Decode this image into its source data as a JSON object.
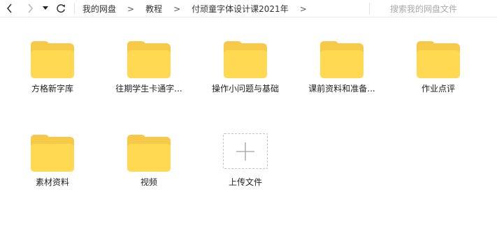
{
  "toolbar": {
    "breadcrumbs": [
      "我的网盘",
      "教程",
      "付顽童字体设计课2021年"
    ],
    "search_placeholder": "搜索我的网盘文件"
  },
  "items": [
    {
      "name": "方格新字库",
      "type": "folder"
    },
    {
      "name": "往期学生卡通字...",
      "type": "folder"
    },
    {
      "name": "操作小问题与基础",
      "type": "folder"
    },
    {
      "name": "课前资料和准备...",
      "type": "folder"
    },
    {
      "name": "作业点评",
      "type": "folder"
    },
    {
      "name": "素材资料",
      "type": "folder"
    },
    {
      "name": "视频",
      "type": "folder"
    },
    {
      "name": "上传文件",
      "type": "upload"
    }
  ],
  "colors": {
    "folder_back": "#f7c948",
    "folder_front": "#ffd952",
    "upload_border": "#c4c4c4"
  },
  "icons": [
    "chevron-left-icon",
    "chevron-right-icon",
    "caret-down-icon",
    "refresh-icon",
    "folder-icon",
    "plus-icon"
  ]
}
